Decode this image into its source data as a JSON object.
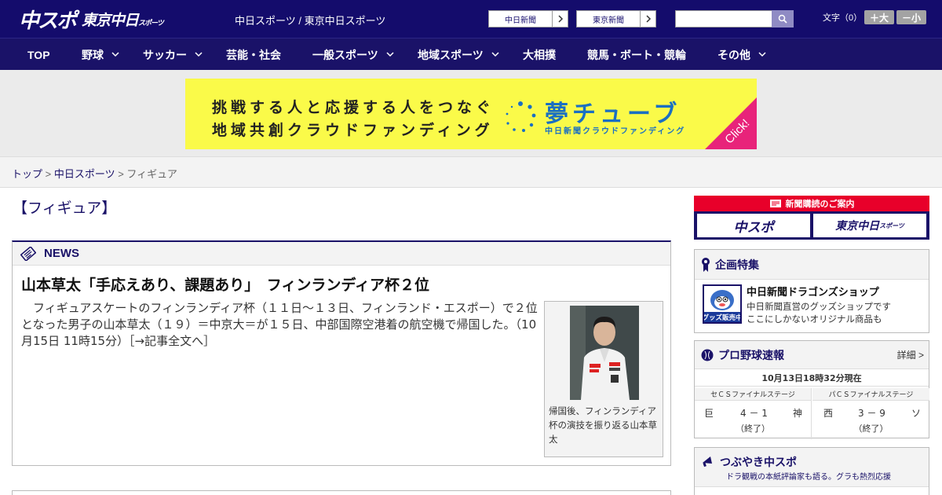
{
  "header": {
    "logo_main": "中スポ",
    "logo_tokyo": "東京中日",
    "logo_tokyo_small": "スポーツ",
    "site_name": "中日スポーツ / 東京中日スポーツ",
    "btn_chunichi": "中日新聞",
    "btn_tokyo": "東京新聞",
    "font_size_label": "文字（0）",
    "font_plus": "＋大",
    "font_minus": "－小"
  },
  "nav": {
    "items": [
      {
        "label": "TOP"
      },
      {
        "label": "野球"
      },
      {
        "label": "サッカー"
      },
      {
        "label": "芸能・社会"
      },
      {
        "label": "一般スポーツ"
      },
      {
        "label": "地域スポーツ"
      },
      {
        "label": "大相撲"
      },
      {
        "label": "競馬・ボート・競輪"
      },
      {
        "label": "その他"
      }
    ]
  },
  "ad": {
    "line1": "挑戦する人と応援する人をつなぐ",
    "line2": "地域共創クラウドファンディング",
    "brand": "夢チューブ",
    "sub": "中日新聞クラウドファンディング",
    "click": "Click!"
  },
  "breadcrumb": {
    "home": "トップ",
    "sep": " > ",
    "section": "中日スポーツ",
    "current": "フィギュア"
  },
  "page": {
    "title": "【フィギュア】"
  },
  "news": {
    "label": "NEWS",
    "headline": "山本草太「手応えあり、課題あり」　フィンランディア杯２位",
    "body": "　フィギュアスケートのフィンランディア杯（１１日～１３日、フィンランド・エスポー）で２位となった男子の山本草太（１９）＝中京大＝が１５日、中部国際空港着の航空機で帰国した。（10月15日 11時15分）",
    "more": "［→記事全文へ］",
    "caption": "帰国後、フィンランディア杯の演技を振り返る山本草太"
  },
  "sidebar": {
    "subscribe_head": "新聞購読のご案内",
    "subscribe_chuspo": "中スポ",
    "subscribe_tokyo": "東京中日",
    "subscribe_tokyo_small": "スポーツ",
    "feature_label": "企画特集",
    "shop_title": "中日新聞ドラゴンズショップ",
    "shop_desc1": "中日新聞直営のグッズショップです",
    "shop_desc2": "ここにしかないオリジナル商品も",
    "shop_badge": "グッズ販売中",
    "baseball_label": "プロ野球速報",
    "detail": "詳細 >",
    "score_time": "10月13日18時32分現在",
    "games": [
      {
        "stage": "セＣＳファイナルステージ",
        "home": "巨",
        "score": "4 － 1",
        "away": "神",
        "status": "（終了）"
      },
      {
        "stage": "パＣＳファイナルステージ",
        "home": "西",
        "score": "3 － 9",
        "away": "ソ",
        "status": "（終了）"
      }
    ],
    "tsubu_label": "つぶやき中スポ",
    "tsubu_sub": "ドラ観戦の本紙評論家も語る。グラも熱烈応援"
  },
  "colors": {
    "navy": "#140c6c",
    "nav": "#1a1268",
    "red": "#e8002a",
    "ad_yellow": "#fafa49",
    "ad_blue": "#1a6fc2"
  }
}
